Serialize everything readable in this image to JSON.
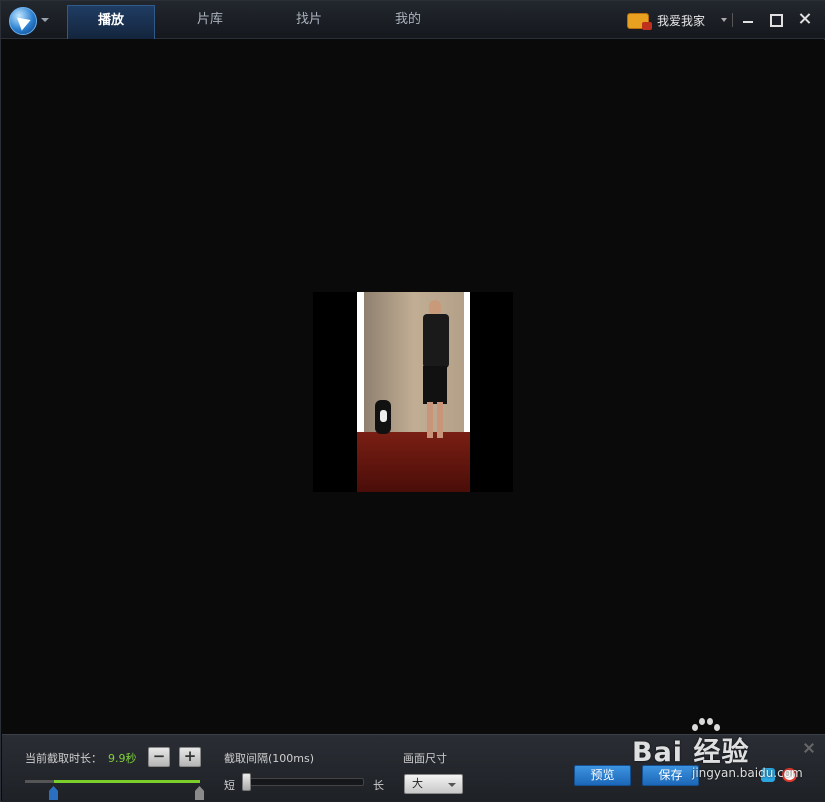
{
  "app": {
    "tabs": [
      {
        "label": "播放",
        "active": true
      },
      {
        "label": "片库",
        "active": false
      },
      {
        "label": "找片",
        "active": false
      },
      {
        "label": "我的",
        "active": false
      }
    ],
    "user_name": "我爱我家",
    "accent_color": "#1c67b8"
  },
  "capture_panel": {
    "current_duration_label": "当前截取时长：",
    "current_duration_value": "9.9秒",
    "minus_label": "−",
    "plus_label": "+",
    "interval_label": "截取间隔(100ms)",
    "short_label": "短",
    "long_label": "长",
    "size_label": "画面尺寸",
    "size_value": "大",
    "preview_label": "预览",
    "save_label": "保存"
  },
  "watermark": {
    "text": "Bai 经验",
    "sub": "jingyan.baidu.com"
  }
}
